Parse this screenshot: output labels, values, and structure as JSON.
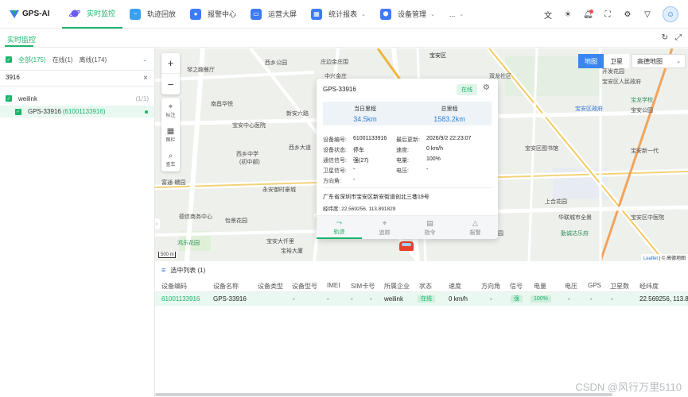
{
  "app": {
    "name": "GPS-AI"
  },
  "nav": {
    "items": [
      {
        "label": "实时监控",
        "icon": "planet-icon",
        "active": true
      },
      {
        "label": "轨迹回放",
        "icon": "route-icon"
      },
      {
        "label": "报警中心",
        "icon": "person-alert-icon"
      },
      {
        "label": "运营大屏",
        "icon": "screen-icon"
      },
      {
        "label": "统计报表",
        "icon": "grid-icon"
      },
      {
        "label": "设备管理",
        "icon": "shield-icon"
      },
      {
        "label": "..."
      }
    ],
    "right_icons": [
      "translate-icon",
      "theme-sun-icon",
      "bell-icon",
      "fullscreen-icon",
      "settings-gear-icon",
      "shirt-icon",
      "user-avatar"
    ]
  },
  "subtab": {
    "label": "实时监控"
  },
  "left": {
    "filters": {
      "all": "全部(175)",
      "online": "在线(1)",
      "offline": "离线(174)"
    },
    "search": {
      "value": "3916"
    },
    "group": {
      "name": "weilink",
      "count": "(1/1)"
    },
    "device": {
      "name": "GPS-33916",
      "id": "(61001133916)"
    }
  },
  "map": {
    "zoom_in": "+",
    "zoom_out": "−",
    "tools": [
      {
        "label": "标注"
      },
      {
        "label": "图栏"
      },
      {
        "label": "查车"
      }
    ],
    "type_map": "地图",
    "type_sat": "卫星",
    "provider": "高德地图",
    "scale": "500 m",
    "attribution_link": "Leaflet",
    "attribution_text": "| © 高德地图",
    "labels": [
      "琴之趣餐厅",
      "西乡公园",
      "庄边金庄围",
      "中兴金庄",
      "宝安区",
      "新安六路",
      "双龙社区",
      "安宝路",
      "南昌华悦",
      "宝安中心医院",
      "西乡中学",
      "(初中部)",
      "西乡大道",
      "富通·蠕园",
      "永安御时豪城",
      "怡景花园",
      "德信商务中心",
      "鸿乐花园",
      "宝安大仟里",
      "宝裕大厦",
      "开发花园",
      "宝安区人民政府",
      "宝安区政府",
      "宝龙学校",
      "宝安公园",
      "宝安区图书馆",
      "上合花园",
      "华联城市全景",
      "勤诚达乐府",
      "灵芝公园",
      "宝安区中医院",
      "宝安新一代"
    ]
  },
  "popup": {
    "title": "GPS-33916",
    "status": "在线",
    "today_label": "当日里程",
    "today_value": "34.5km",
    "total_label": "总里程",
    "total_value": "1583.2km",
    "device_no_label": "设备编号:",
    "device_no": "61001133916",
    "last_update_label": "最后更新:",
    "last_update": "2026/9/2 22:23:07",
    "state_label": "设备状态:",
    "state": "停车",
    "speed_label": "速度:",
    "speed": "0 km/h",
    "signal_label": "通信信号:",
    "signal": "强(27)",
    "battery_label": "电量:",
    "battery": "100%",
    "sat_label": "卫星信号:",
    "sat": "-",
    "voltage_label": "电压:",
    "voltage": "-",
    "heading_label": "方向角:",
    "heading": "-",
    "address": "广东省深圳市宝安区新安街道创北三巷19号",
    "coord_label": "经纬度:",
    "coord": "22.569256, 113.891829",
    "actions": [
      {
        "label": "轨迹",
        "icon": "track-icon",
        "active": true
      },
      {
        "label": "追踪",
        "icon": "pin-icon"
      },
      {
        "label": "指令",
        "icon": "document-icon"
      },
      {
        "label": "报警",
        "icon": "bell-icon"
      }
    ]
  },
  "list": {
    "title": "选中列表 (1)",
    "headers": [
      "设备编码",
      "设备名称",
      "设备类型",
      "设备型号",
      "IMEI",
      "SIM卡号",
      "所属企业",
      "状态",
      "速度",
      "方向角",
      "信号",
      "电量",
      "电压",
      "GPS",
      "卫星数",
      "经纬度"
    ],
    "row": [
      "61001133916",
      "GPS-33916",
      "-",
      "-",
      "-",
      "-",
      "weilink",
      "在线",
      "0 km/h",
      "-",
      "强",
      "100%",
      "-",
      "-",
      "-",
      "22.569256, 113.8"
    ]
  },
  "watermark": "CSDN @风行万里5110",
  "colors": {
    "accent": "#19b56b",
    "blue": "#2e7dd8"
  }
}
